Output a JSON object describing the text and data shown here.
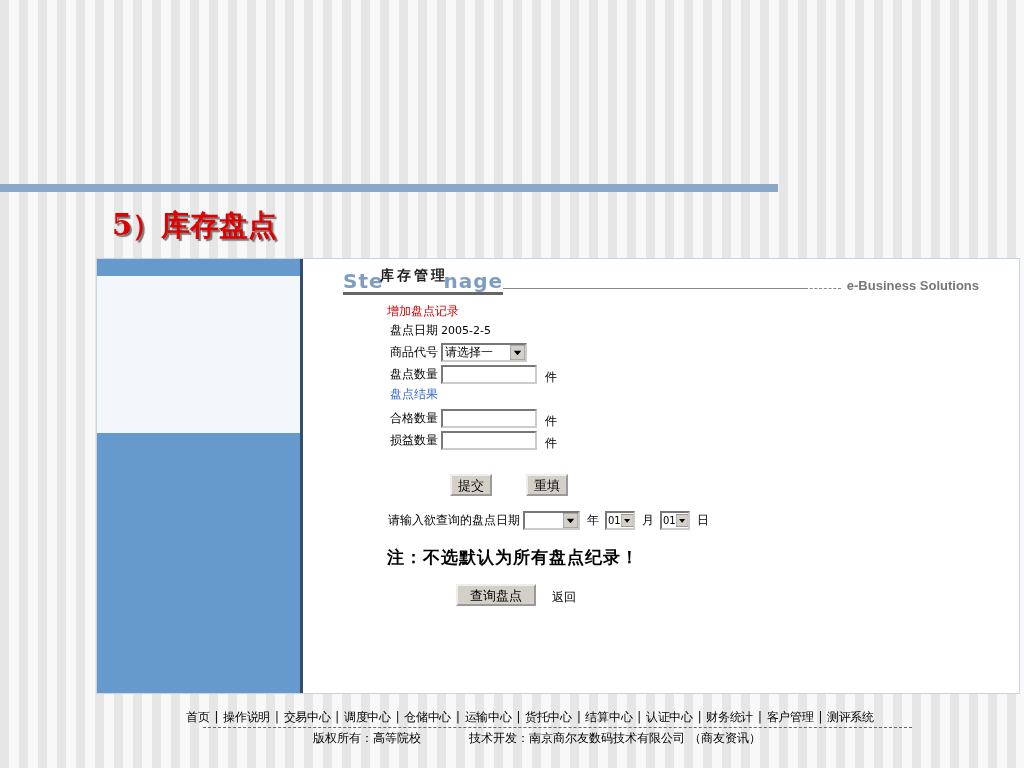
{
  "slide": {
    "title": "5）库存盘点"
  },
  "header": {
    "logo_fragments": [
      "Ste",
      "nage"
    ],
    "title": "库存管理",
    "tagline": "e-Business Solutions"
  },
  "form": {
    "heading": "增加盘点记录",
    "date_label": "盘点日期",
    "date_value": "2005-2-5",
    "fields": [
      {
        "kind": "select",
        "label": "商品代号",
        "value": "请选择一"
      },
      {
        "kind": "input",
        "label": "盘点数量",
        "unit": "件"
      },
      {
        "kind": "section",
        "label": "盘点结果"
      },
      {
        "kind": "input",
        "label": "合格数量",
        "unit": "件"
      },
      {
        "kind": "input",
        "label": "损益数量",
        "unit": "件"
      }
    ],
    "buttons": [
      "提交",
      "重填"
    ]
  },
  "query": {
    "label": "请输入欲查询的盘点日期",
    "parts": [
      {
        "unit": "年"
      },
      {
        "value": "01",
        "unit": "月"
      },
      {
        "value": "01",
        "unit": "日"
      }
    ],
    "note": "注：不选默认为所有盘点纪录！",
    "button": "查询盘点",
    "back_link": "返回"
  },
  "footer": {
    "separator": "|",
    "nav": [
      "首页",
      "操作说明",
      "交易中心",
      "调度中心",
      "仓储中心",
      "运输中心",
      "货托中心",
      "结算中心",
      "认证中心",
      "财务统计",
      "客户管理",
      "测评系统"
    ],
    "copyright": "版权所有：高等院校",
    "developer": "技术开发：南京商尔友数码技术有限公司 （商友资讯）"
  }
}
